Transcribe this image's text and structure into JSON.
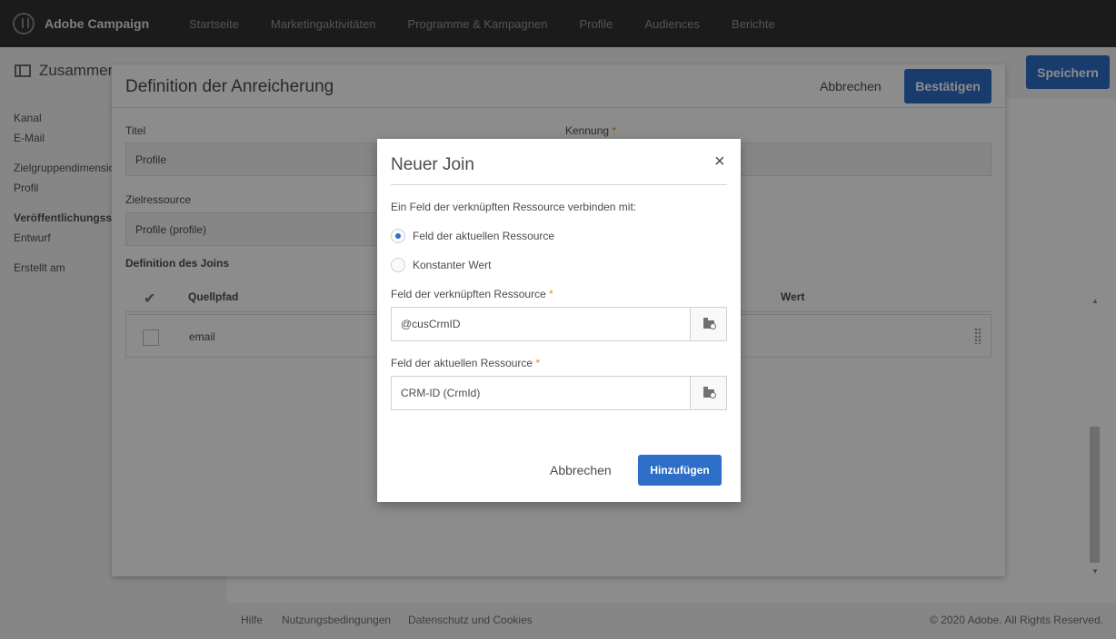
{
  "app": {
    "name": "Adobe Campaign"
  },
  "nav": [
    "Startseite",
    "Marketingaktivitäten",
    "Programme & Kampagnen",
    "Profile",
    "Audiences",
    "Berichte"
  ],
  "page": {
    "title": "Zusammen",
    "save_label": "Speichern"
  },
  "sidebar": {
    "channel_label": "Kanal",
    "channel_value": "E-Mail",
    "target_label": "Zielgruppendimensio",
    "target_value": "Profil",
    "pub_label": "Veröffentlichungssta",
    "pub_value": "Entwurf",
    "created_label": "Erstellt am"
  },
  "footer": {
    "links": [
      "Hilfe",
      "Nutzungsbedingungen",
      "Datenschutz und Cookies"
    ],
    "copyright": "© 2020 Adobe. All Rights Reserved."
  },
  "enrichment_dialog": {
    "title": "Definition der Anreicherung",
    "cancel_label": "Abbrechen",
    "confirm_label": "Bestätigen",
    "title_label": "Titel",
    "title_value": "Profile",
    "id_label": "Kennung",
    "id_required": "*",
    "target_label": "Zielressource",
    "target_value": "Profile (profile)",
    "join_heading": "Definition des Joins",
    "table": {
      "columns": [
        "Quellpfad",
        "Wert"
      ],
      "rows": [
        {
          "source": "email"
        }
      ]
    }
  },
  "join_modal": {
    "title": "Neuer Join",
    "close": "×",
    "description": "Ein Feld der verknüpften Ressource verbinden mit:",
    "option_current": "Feld der aktuellen Ressource",
    "option_constant": "Konstanter Wert",
    "selected_option": "Feld der aktuellen Ressource",
    "linked_field_label": "Feld der verknüpften Ressource",
    "linked_field_value": "@cusCrmID",
    "current_field_label": "Feld der aktuellen Ressource",
    "current_field_value": "CRM-ID (CrmId)",
    "required_mark": "*",
    "cancel_label": "Abbrechen",
    "add_label": "Hinzufügen",
    "accent_color": "#2d6ec7",
    "required_color": "#e68619"
  }
}
